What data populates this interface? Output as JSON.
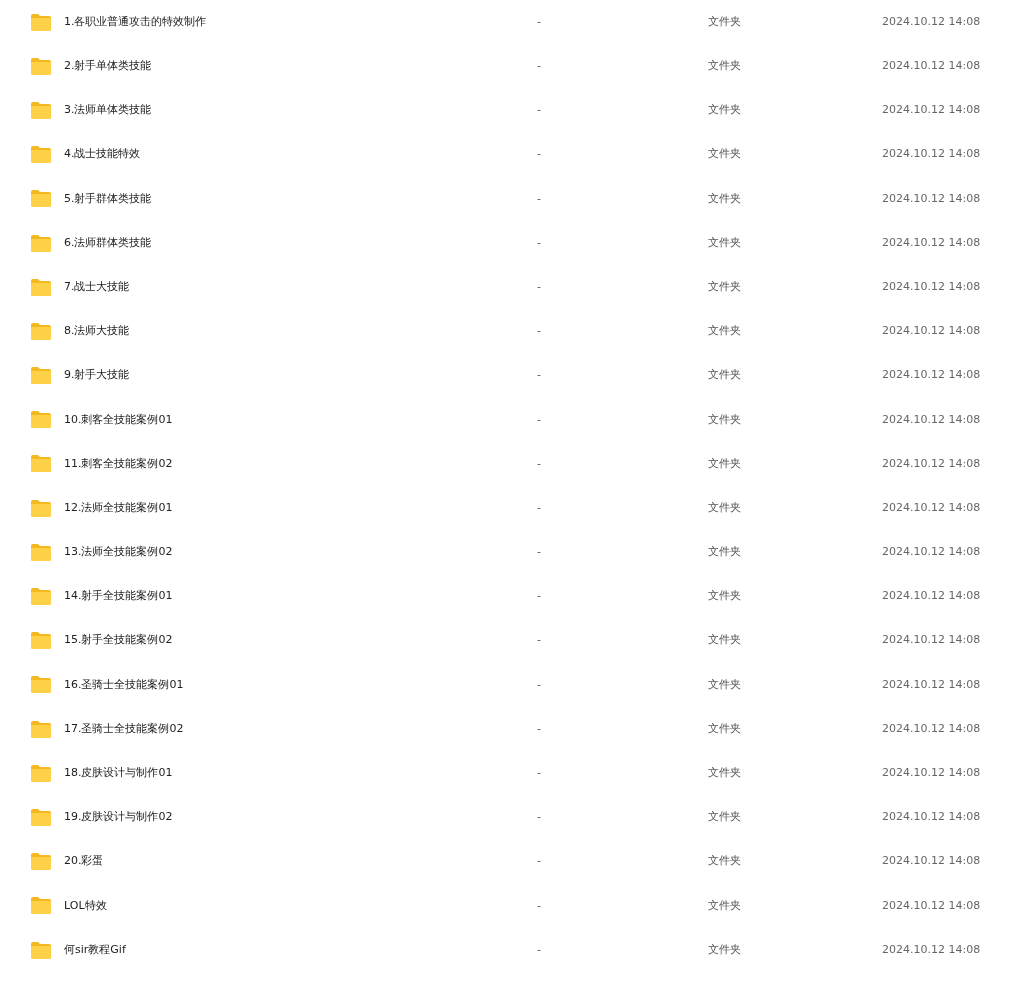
{
  "files": [
    {
      "name": "1.各职业普通攻击的特效制作",
      "size": "-",
      "type": "文件夹",
      "modified": "2024.10.12 14:08"
    },
    {
      "name": "2.射手单体类技能",
      "size": "-",
      "type": "文件夹",
      "modified": "2024.10.12 14:08"
    },
    {
      "name": "3.法师单体类技能",
      "size": "-",
      "type": "文件夹",
      "modified": "2024.10.12 14:08"
    },
    {
      "name": "4.战士技能特效",
      "size": "-",
      "type": "文件夹",
      "modified": "2024.10.12 14:08"
    },
    {
      "name": "5.射手群体类技能",
      "size": "-",
      "type": "文件夹",
      "modified": "2024.10.12 14:08"
    },
    {
      "name": "6.法师群体类技能",
      "size": "-",
      "type": "文件夹",
      "modified": "2024.10.12 14:08"
    },
    {
      "name": "7.战士大技能",
      "size": "-",
      "type": "文件夹",
      "modified": "2024.10.12 14:08"
    },
    {
      "name": "8.法师大技能",
      "size": "-",
      "type": "文件夹",
      "modified": "2024.10.12 14:08"
    },
    {
      "name": "9.射手大技能",
      "size": "-",
      "type": "文件夹",
      "modified": "2024.10.12 14:08"
    },
    {
      "name": "10.刺客全技能案例01",
      "size": "-",
      "type": "文件夹",
      "modified": "2024.10.12 14:08"
    },
    {
      "name": "11.刺客全技能案例02",
      "size": "-",
      "type": "文件夹",
      "modified": "2024.10.12 14:08"
    },
    {
      "name": "12.法师全技能案例01",
      "size": "-",
      "type": "文件夹",
      "modified": "2024.10.12 14:08"
    },
    {
      "name": "13.法师全技能案例02",
      "size": "-",
      "type": "文件夹",
      "modified": "2024.10.12 14:08"
    },
    {
      "name": "14.射手全技能案例01",
      "size": "-",
      "type": "文件夹",
      "modified": "2024.10.12 14:08"
    },
    {
      "name": "15.射手全技能案例02",
      "size": "-",
      "type": "文件夹",
      "modified": "2024.10.12 14:08"
    },
    {
      "name": "16.圣骑士全技能案例01",
      "size": "-",
      "type": "文件夹",
      "modified": "2024.10.12 14:08"
    },
    {
      "name": "17.圣骑士全技能案例02",
      "size": "-",
      "type": "文件夹",
      "modified": "2024.10.12 14:08"
    },
    {
      "name": "18.皮肤设计与制作01",
      "size": "-",
      "type": "文件夹",
      "modified": "2024.10.12 14:08"
    },
    {
      "name": "19.皮肤设计与制作02",
      "size": "-",
      "type": "文件夹",
      "modified": "2024.10.12 14:08"
    },
    {
      "name": "20.彩蛋",
      "size": "-",
      "type": "文件夹",
      "modified": "2024.10.12 14:08"
    },
    {
      "name": "LOL特效",
      "size": "-",
      "type": "文件夹",
      "modified": "2024.10.12 14:08"
    },
    {
      "name": "何sir教程Gif",
      "size": "-",
      "type": "文件夹",
      "modified": "2024.10.12 14:08"
    }
  ]
}
